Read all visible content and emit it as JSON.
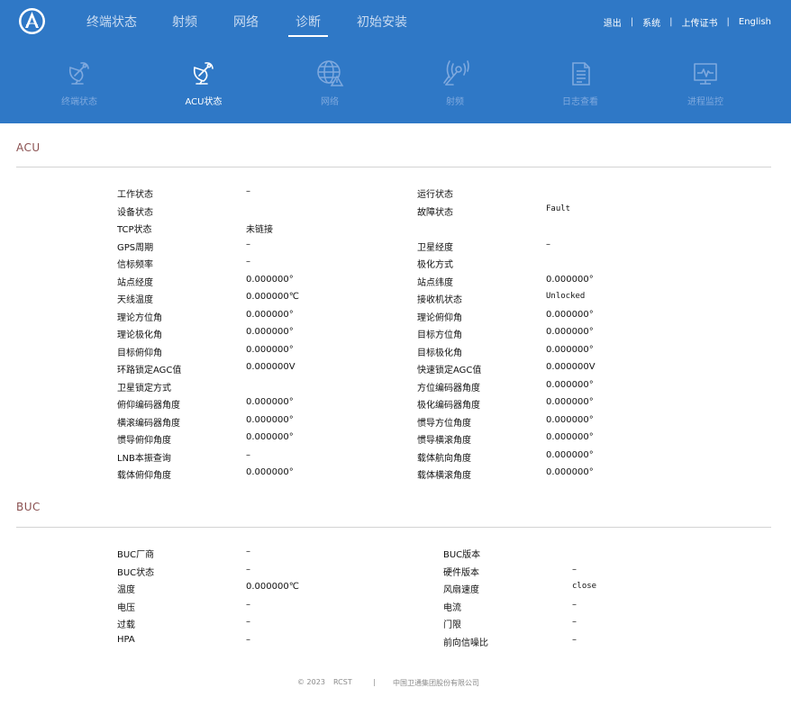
{
  "header": {
    "tabs": [
      {
        "label": "终端状态",
        "active": false
      },
      {
        "label": "射频",
        "active": false
      },
      {
        "label": "网络",
        "active": false
      },
      {
        "label": "诊断",
        "active": true
      },
      {
        "label": "初始安装",
        "active": false
      }
    ],
    "links": {
      "logout": "退出",
      "system": "系统",
      "upload_cert": "上传证书",
      "language": "English",
      "separator": "|"
    },
    "colors": {
      "bg": "#2f78c6",
      "active_text": "#ffffff",
      "inactive_text": "#c9dbf1"
    }
  },
  "subnav": {
    "items": [
      {
        "label": "终端状态",
        "icon": "satellite-dish-icon",
        "active": false
      },
      {
        "label": "ACU状态",
        "icon": "satellite-dish-icon",
        "active": true
      },
      {
        "label": "网络",
        "icon": "globe-warning-icon",
        "active": false
      },
      {
        "label": "射频",
        "icon": "signal-antenna-icon",
        "active": false
      },
      {
        "label": "日志查看",
        "icon": "document-log-icon",
        "active": false
      },
      {
        "label": "进程监控",
        "icon": "monitor-chart-icon",
        "active": false
      }
    ]
  },
  "acu": {
    "title": "ACU",
    "rows": [
      [
        "工作状态",
        "–",
        "运行状态",
        ""
      ],
      [
        "设备状态",
        "",
        "故障状态",
        "Fault"
      ],
      [
        "TCP状态",
        "未链接",
        "",
        ""
      ],
      [
        "GPS周期",
        "–",
        "卫星经度",
        "–"
      ],
      [
        "信标频率",
        "–",
        "极化方式",
        ""
      ],
      [
        "站点经度",
        "0.000000°",
        "站点纬度",
        "0.000000°"
      ],
      [
        "天线温度",
        "0.000000℃",
        "接收机状态",
        "Unlocked"
      ],
      [
        "理论方位角",
        "0.000000°",
        "理论俯仰角",
        "0.000000°"
      ],
      [
        "理论极化角",
        "0.000000°",
        "目标方位角",
        "0.000000°"
      ],
      [
        "目标俯仰角",
        "0.000000°",
        "目标极化角",
        "0.000000°"
      ],
      [
        "环路锁定AGC值",
        "0.000000V",
        "快速锁定AGC值",
        "0.000000V"
      ],
      [
        "卫星锁定方式",
        "",
        "方位编码器角度",
        "0.000000°"
      ],
      [
        "俯仰编码器角度",
        "0.000000°",
        "极化编码器角度",
        "0.000000°"
      ],
      [
        "横滚编码器角度",
        "0.000000°",
        "惯导方位角度",
        "0.000000°"
      ],
      [
        "惯导俯仰角度",
        "0.000000°",
        "惯导横滚角度",
        "0.000000°"
      ],
      [
        "LNB本振查询",
        "–",
        "载体航向角度",
        "0.000000°"
      ],
      [
        "载体俯仰角度",
        "0.000000°",
        "载体横滚角度",
        "0.000000°"
      ]
    ]
  },
  "buc": {
    "title": "BUC",
    "rows": [
      [
        "BUC厂商",
        "–",
        "BUC版本",
        ""
      ],
      [
        "BUC状态",
        "–",
        "硬件版本",
        "–"
      ],
      [
        "温度",
        "0.000000℃",
        "风扇速度",
        "close"
      ],
      [
        "电压",
        "–",
        "电流",
        "–"
      ],
      [
        "过载",
        "–",
        "门限",
        "–"
      ],
      [
        "HPA",
        "–",
        "前向信噪比",
        "–"
      ]
    ]
  },
  "footer": {
    "copyright": "© 2023",
    "product": "RCST",
    "separator": "|",
    "company": "中国卫通集团股份有限公司"
  }
}
